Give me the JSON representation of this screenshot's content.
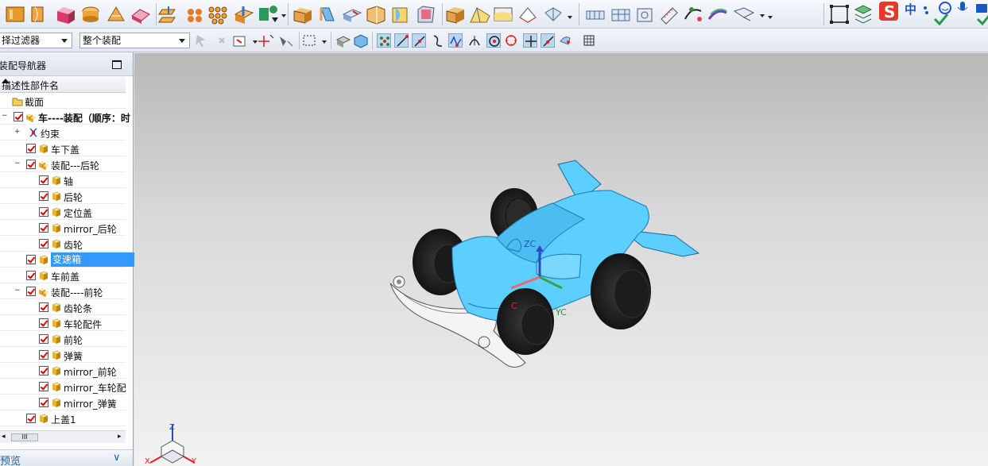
{
  "toolbar": {
    "filter_combo": "择过滤器",
    "scope_combo": "整个装配",
    "ime_label": "中"
  },
  "navigator": {
    "title": "装配导航器",
    "column_header": "描述性部件名",
    "items": [
      {
        "label": "截面"
      },
      {
        "label": "车----装配（顺序：时"
      },
      {
        "label": "约束"
      },
      {
        "label": "车下盖"
      },
      {
        "label": "装配---后轮"
      },
      {
        "label": "轴"
      },
      {
        "label": "后轮"
      },
      {
        "label": "定位盖"
      },
      {
        "label": "mirror_后轮"
      },
      {
        "label": "齿轮"
      },
      {
        "label": "变速箱"
      },
      {
        "label": "车前盖"
      },
      {
        "label": "装配----前轮"
      },
      {
        "label": "齿轮条"
      },
      {
        "label": "车轮配件"
      },
      {
        "label": "前轮"
      },
      {
        "label": "弹簧"
      },
      {
        "label": "mirror_前轮"
      },
      {
        "label": "mirror_车轮配"
      },
      {
        "label": "mirror_弹簧"
      },
      {
        "label": "上盖1"
      }
    ],
    "scroll_thumb": "III",
    "preview_label": "预览"
  },
  "viewport": {
    "csys": {
      "zc": "ZC",
      "yc": "YC",
      "xc": "C"
    },
    "triad": {
      "z": "Z",
      "x": "X",
      "y": "Y"
    }
  },
  "colors": {
    "body_blue": "#5ccfff",
    "tire_black": "#1e1e1e",
    "selection": "#3399ff",
    "check_red": "#dd0000"
  }
}
